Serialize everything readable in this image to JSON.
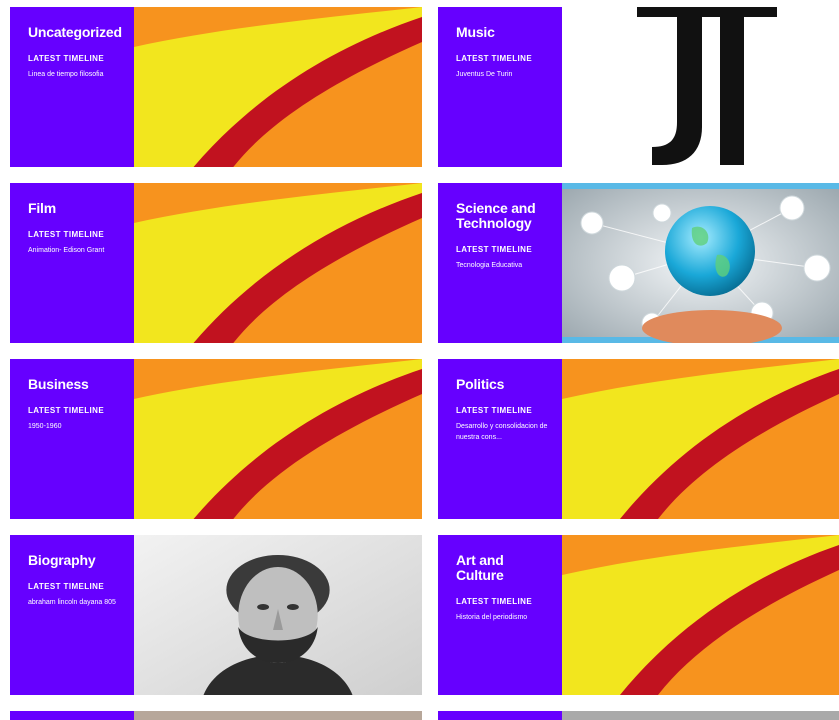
{
  "latest_label": "LATEST TIMELINE",
  "categories": [
    {
      "title": "Uncategorized",
      "latest": "Linea de tiempo filosofia",
      "image": "orange-swoosh"
    },
    {
      "title": "Music",
      "latest": "Juventus De Turin",
      "image": "juventus-logo"
    },
    {
      "title": "Film",
      "latest": "Animation- Edison Grant",
      "image": "orange-swoosh"
    },
    {
      "title": "Science and Technology",
      "latest": "Tecnologia Educativa",
      "image": "globe-network"
    },
    {
      "title": "Business",
      "latest": "1950-1960",
      "image": "orange-swoosh"
    },
    {
      "title": "Politics",
      "latest": "Desarrollo y consolidacion de nuestra cons...",
      "image": "orange-swoosh"
    },
    {
      "title": "Biography",
      "latest": "abraham lincoln dayana 805",
      "image": "lincoln-portrait"
    },
    {
      "title": "Art and Culture",
      "latest": "Historia del periodismo",
      "image": "orange-swoosh"
    }
  ],
  "colors": {
    "panel": "#6600ff",
    "orange": "#f7931e",
    "yellow": "#f2e61e",
    "red": "#c1121f"
  }
}
